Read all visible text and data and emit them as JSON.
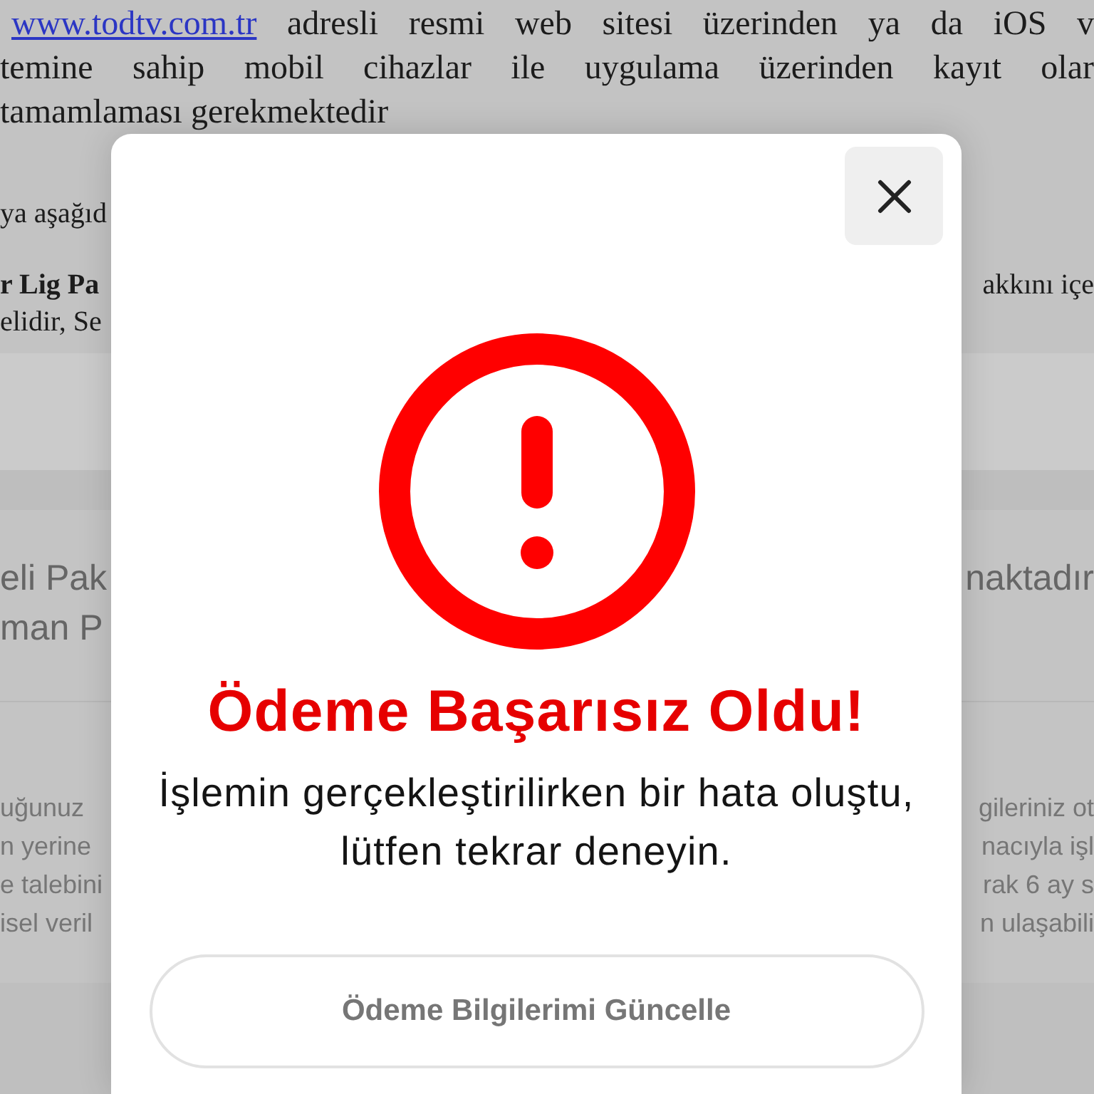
{
  "page": {
    "paragraph_lines": [
      {
        "kind": "link_line",
        "link": "www.todtv.com.tr",
        "text": "adresli resmi web sitesi üzerinden ya da iOS v"
      },
      {
        "kind": "plain",
        "text": "temine sahip mobil cihazlar ile uygulama üzerinden kayıt olar"
      },
      {
        "kind": "plain",
        "text": "tamamlaması gerekmektedir"
      }
    ],
    "detail_rows": [
      {
        "left": {
          "kind": "regular",
          "text": "ya aşağıd"
        }
      },
      {
        "left": {
          "kind": "bold",
          "text": "r Lig Pa"
        },
        "right": {
          "kind": "regular",
          "text": "akkını içe"
        }
      },
      {
        "left": {
          "kind": "regular",
          "text": "elidir, Se"
        }
      }
    ],
    "highlight_rows": [
      {
        "left": "eli Pak",
        "right": "naktadır"
      },
      {
        "left": "man P"
      }
    ],
    "info_rows": [
      {
        "left": "uğunuz",
        "right": "gileriniz ot"
      },
      {
        "left": "n yerine",
        "right": "nacıyla işl"
      },
      {
        "left": "e talebini",
        "right": "rak 6 ay s"
      },
      {
        "left": "isel veril",
        "right": "n ulaşabili"
      }
    ]
  },
  "dialog": {
    "title": "Ödeme Başarısız Oldu!",
    "message": "İşlemin gerçekleştirilirken bir hata oluştu, lütfen tekrar deneyin.",
    "button": "Ödeme Bilgilerimi Güncelle"
  }
}
